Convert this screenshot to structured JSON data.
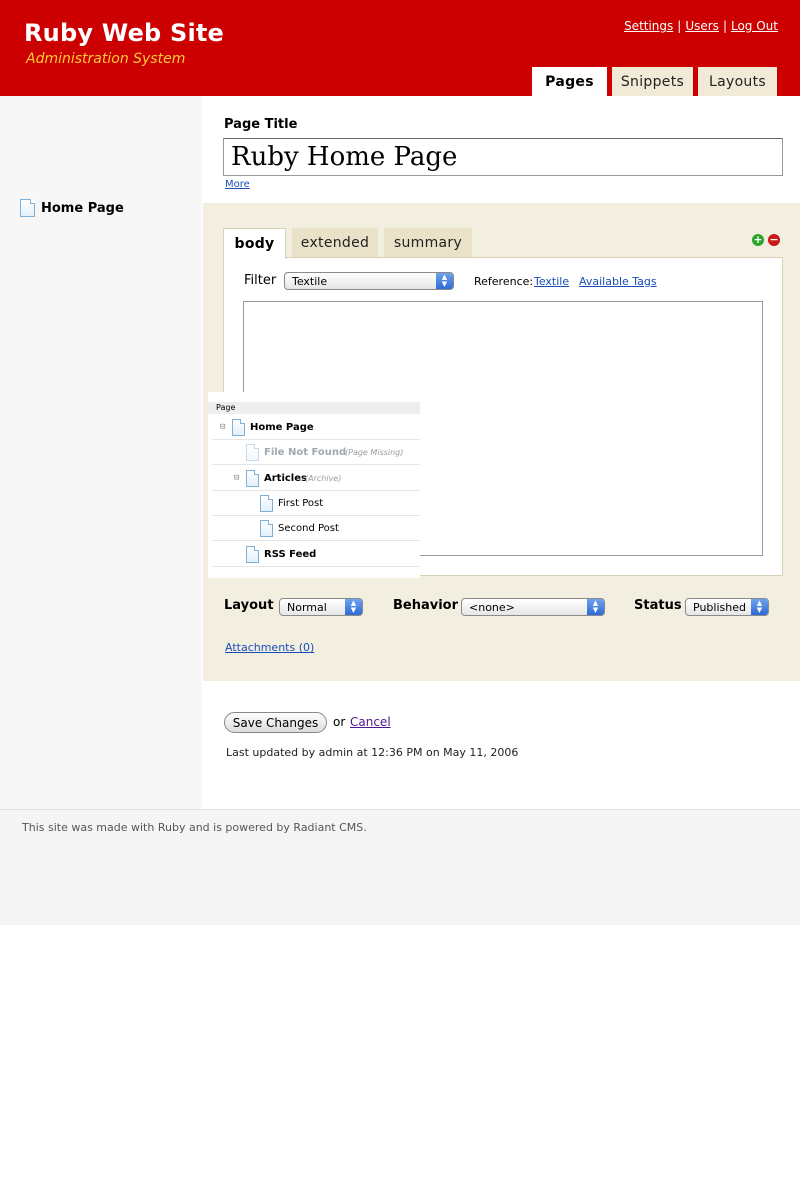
{
  "header": {
    "site_title": "Ruby Web Site",
    "subtitle": "Administration System",
    "links": [
      "Settings",
      "Users",
      "Log Out"
    ],
    "link_separator": "|",
    "tabs": [
      {
        "label": "Pages",
        "active": true
      },
      {
        "label": "Snippets",
        "active": false
      },
      {
        "label": "Layouts",
        "active": false
      }
    ],
    "colors": {
      "background": "#cc0000",
      "subtitle": "#ffcc33"
    }
  },
  "sidebar": {
    "items": [
      {
        "label": "Home Page",
        "icon": "page-icon"
      }
    ]
  },
  "page_title": {
    "label": "Page Title",
    "value": "Ruby Home Page",
    "more_link": "More"
  },
  "parts": {
    "tabs": [
      {
        "label": "body",
        "active": true
      },
      {
        "label": "extended",
        "active": false
      },
      {
        "label": "summary",
        "active": false
      }
    ],
    "add_icon": "plus-circle-icon",
    "remove_icon": "minus-circle-icon",
    "filter_label": "Filter",
    "filter_value": "Textile",
    "reference_label": "Reference:",
    "reference_links": [
      "Textile",
      "Available Tags"
    ],
    "content": ""
  },
  "tree_overlay": {
    "header": "Page",
    "rows": [
      {
        "name": "Home Page",
        "note": "",
        "expander": "⊟",
        "style": "bold"
      },
      {
        "name": "File Not Found",
        "note": "(Page Missing)",
        "expander": "",
        "style": "faded"
      },
      {
        "name": "Articles",
        "note": "(Archive)",
        "expander": "⊟",
        "style": "bold"
      },
      {
        "name": "First Post",
        "note": "",
        "expander": "",
        "style": "normal"
      },
      {
        "name": "Second Post",
        "note": "",
        "expander": "",
        "style": "normal"
      },
      {
        "name": "RSS Feed",
        "note": "",
        "expander": "",
        "style": "bold"
      }
    ]
  },
  "settings": {
    "layout_label": "Layout",
    "layout_value": "Normal",
    "behavior_label": "Behavior",
    "behavior_value": "<none>",
    "status_label": "Status",
    "status_value": "Published",
    "attachments_link": "Attachments (0)"
  },
  "actions": {
    "save_label": "Save Changes",
    "or_text": "or",
    "cancel_label": "Cancel",
    "last_updated": "Last updated by admin at 12:36 PM on May 11, 2006"
  },
  "footer": {
    "text": "This site was made with Ruby and is powered by Radiant CMS."
  }
}
